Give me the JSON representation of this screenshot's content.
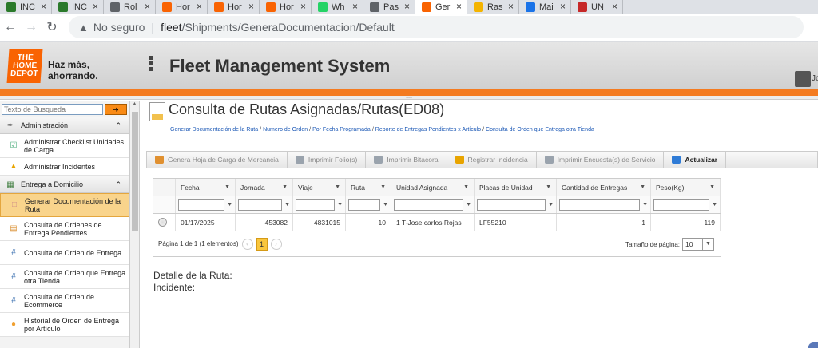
{
  "browser": {
    "tabs": [
      {
        "label": "INC",
        "color": "#2b7a2b"
      },
      {
        "label": "INC",
        "color": "#2b7a2b"
      },
      {
        "label": "Rol",
        "color": "#5f6368"
      },
      {
        "label": "Hor",
        "color": "#f96302"
      },
      {
        "label": "Hor",
        "color": "#f96302"
      },
      {
        "label": "Hor",
        "color": "#f96302"
      },
      {
        "label": "Wh",
        "color": "#25d366"
      },
      {
        "label": "Pas",
        "color": "#5f6368"
      },
      {
        "label": "Ger",
        "color": "#f96302",
        "active": true
      },
      {
        "label": "Ras",
        "color": "#f4b400"
      },
      {
        "label": "Mai",
        "color": "#1a73e8"
      },
      {
        "label": "UN",
        "color": "#c62828"
      }
    ],
    "security_label": "No seguro",
    "url_host": "fleet",
    "url_path": "/Shipments/GeneraDocumentacion/Default"
  },
  "header": {
    "logo_text": "THE HOME DEPOT",
    "slogan_line1": "Haz más,",
    "slogan_line2": "ahorrando.",
    "system_title": "Fleet Management System",
    "splitter_dots": "....",
    "user_text": "Jo"
  },
  "sidebar": {
    "search_placeholder": "Texto de Busqueda",
    "sections": [
      {
        "label": "Administración",
        "items": [
          {
            "label": "Administrar Checklist Unidades de Carga",
            "icon": "checklist-icon"
          },
          {
            "label": "Administrar Incidentes",
            "icon": "warning-icon"
          }
        ]
      },
      {
        "label": "Entrega a Domicilio",
        "items": [
          {
            "label": "Generar Documentación de la Ruta",
            "icon": "document-icon",
            "selected": true
          },
          {
            "label": "Consulta de Ordenes de Entrega Pendientes",
            "icon": "pending-icon"
          },
          {
            "label": "Consulta de Orden de Entrega",
            "icon": "hash-icon"
          },
          {
            "label": "Consulta de Orden que Entrega otra Tienda",
            "icon": "hash-icon"
          },
          {
            "label": "Consulta de Orden de Ecommerce",
            "icon": "hash-icon"
          },
          {
            "label": "Historial de Orden de Entrega por Artículo",
            "icon": "history-icon"
          }
        ]
      }
    ]
  },
  "main": {
    "page_title": "Consulta de Rutas Asignadas/Rutas(ED08)",
    "breadcrumbs": [
      "Generar Documentación de la Ruta",
      "Numero de Orden",
      "Por Fecha Programada",
      "Reporte de Entregas Pendientes x Artículo",
      "Consulta de Orden que Entrega otra Tienda"
    ],
    "breadcrumb_sep": "/",
    "toolbar": [
      {
        "label": "Genera Hoja de Carga de Mercancia",
        "enabled": false,
        "icon": "document-icon"
      },
      {
        "label": "Imprimir Folio(s)",
        "enabled": false,
        "icon": "printer-icon"
      },
      {
        "label": "Imprimir Bitacora",
        "enabled": false,
        "icon": "printer-icon"
      },
      {
        "label": "Registrar Incidencia",
        "enabled": false,
        "icon": "warning-icon"
      },
      {
        "label": "Imprimir Encuesta(s) de Servicio",
        "enabled": false,
        "icon": "printer-icon"
      },
      {
        "label": "Actualizar",
        "enabled": true,
        "icon": "refresh-icon"
      }
    ],
    "grid": {
      "columns": [
        "Fecha",
        "Jornada",
        "Viaje",
        "Ruta",
        "Unidad Asignada",
        "Placas de Unidad",
        "Cantidad de Entregas",
        "Peso(Kg)"
      ],
      "rows": [
        [
          "01/17/2025",
          "453082",
          "4831015",
          "10",
          "1 T-Jose carlos Rojas",
          "LF55210",
          "1",
          "119"
        ]
      ]
    },
    "pager": {
      "summary": "Página 1 de 1 (1 elementos)",
      "current_page": "1",
      "size_label": "Tamaño de página:",
      "size_value": "10"
    },
    "detail_label": "Detalle de la Ruta:",
    "incident_label": "Incidente:"
  }
}
